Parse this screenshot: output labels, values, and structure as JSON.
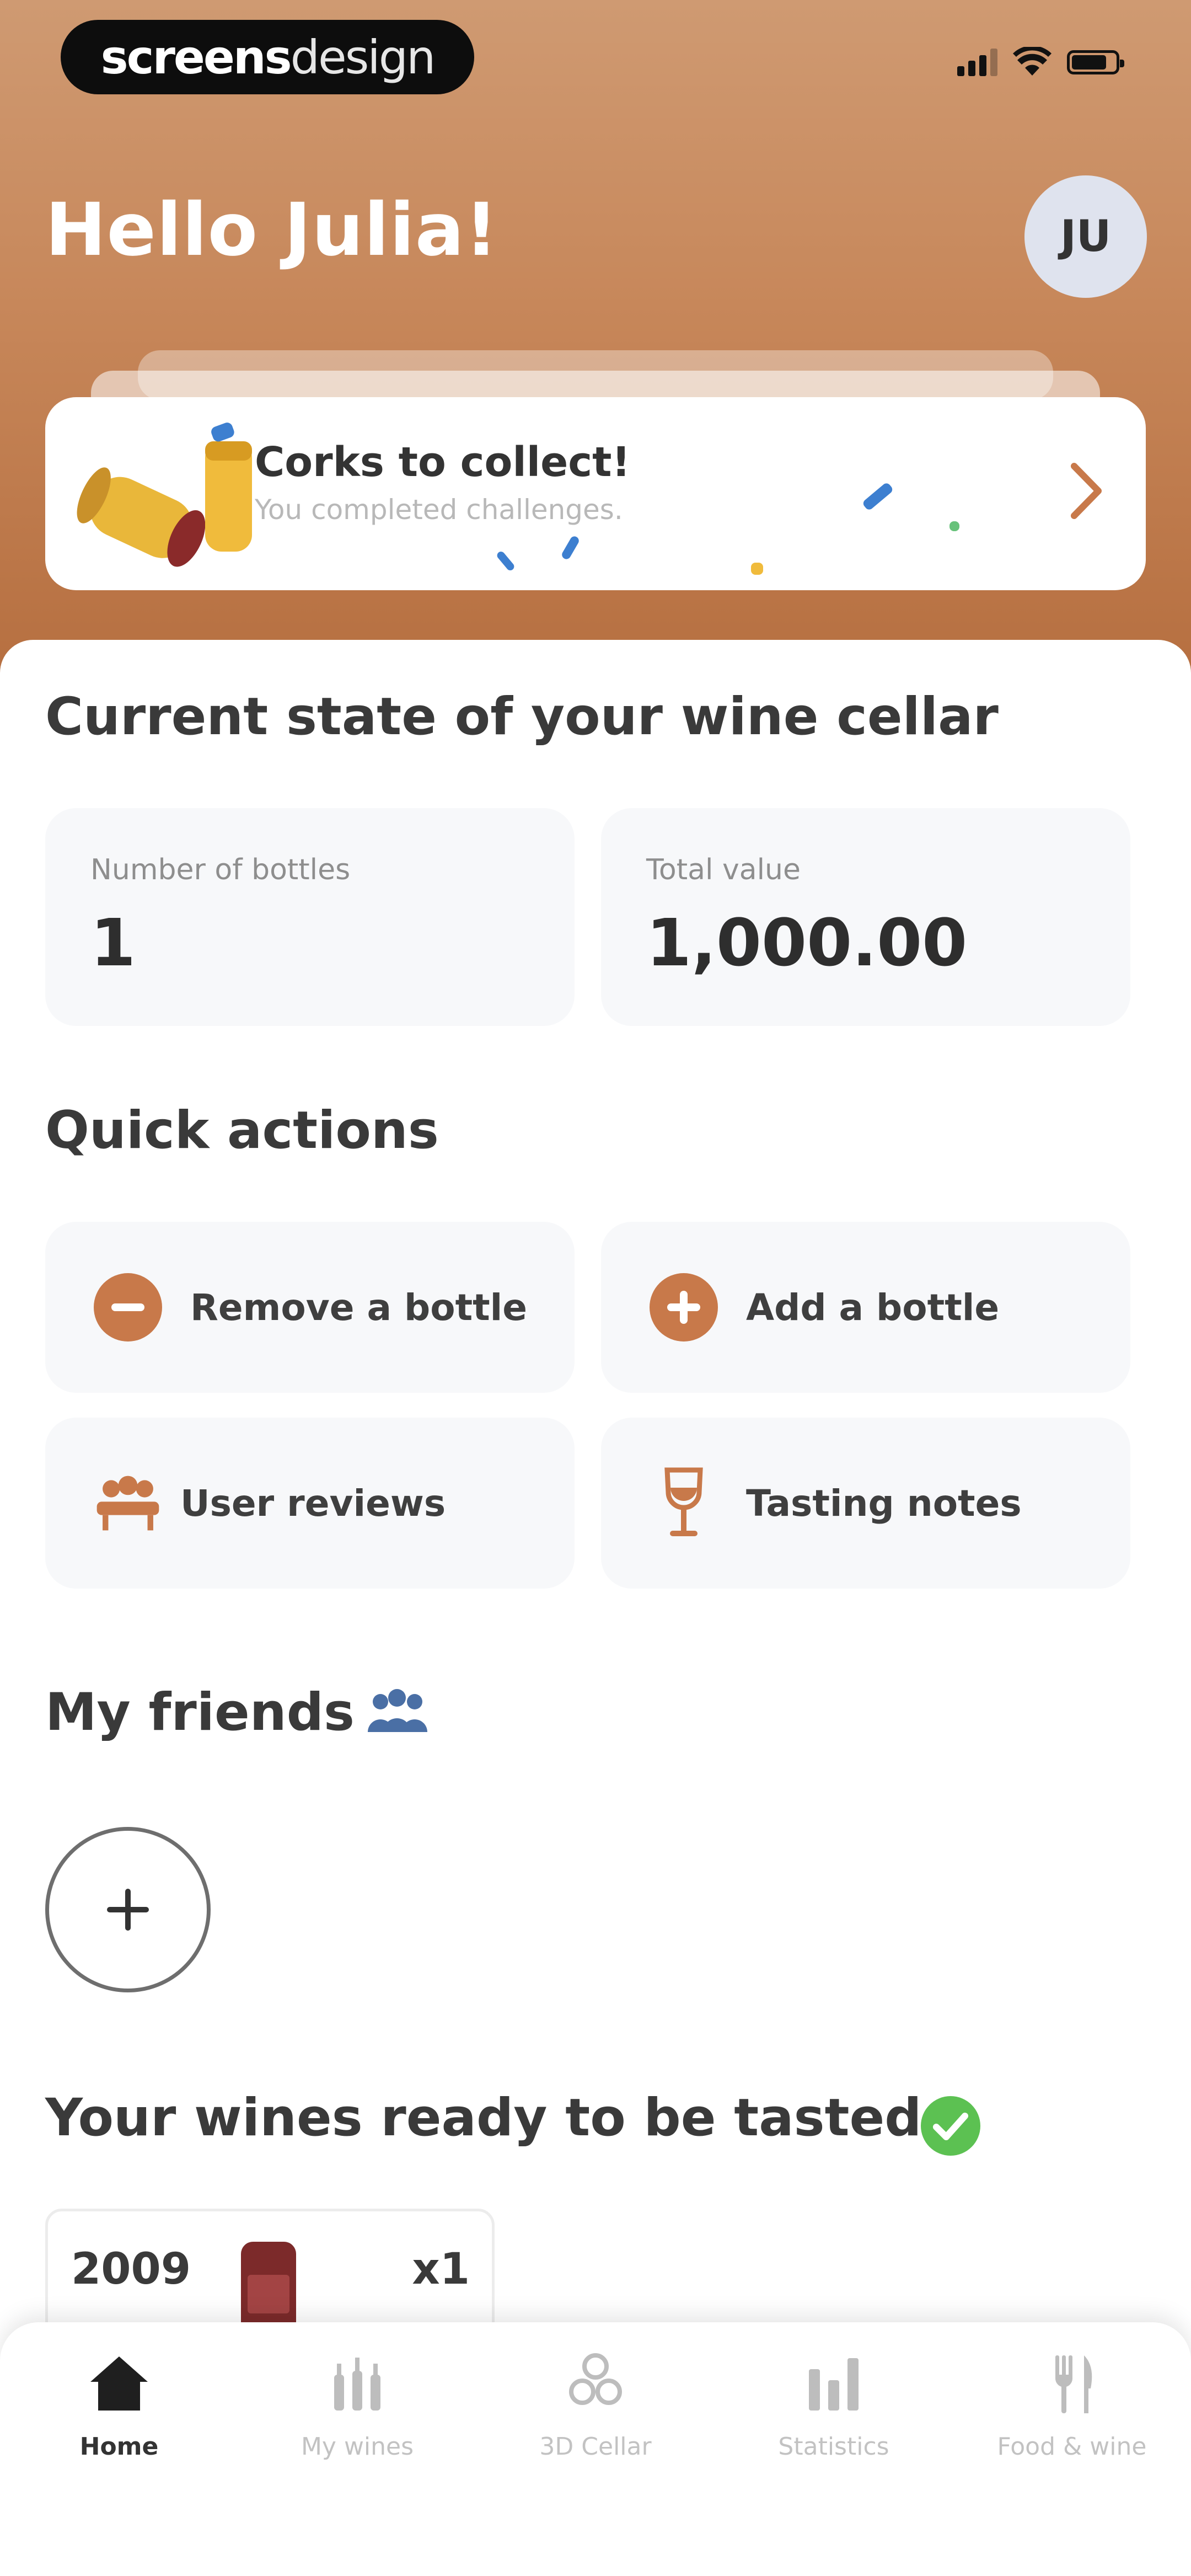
{
  "status_bar": {
    "brand_bold": "screens",
    "brand_light": "design"
  },
  "header": {
    "greeting": "Hello Julia!",
    "avatar_initials": "JU"
  },
  "cork_banner": {
    "title": "Corks to collect!",
    "subtitle": "You completed challenges."
  },
  "cellar": {
    "title": "Current state of your wine cellar",
    "bottles_label": "Number of bottles",
    "bottles_value": "1",
    "value_label": "Total value",
    "value_value": "1,000.00"
  },
  "quick_actions": {
    "title": "Quick actions",
    "remove_label": "Remove a bottle",
    "add_label": "Add a bottle",
    "reviews_label": "User reviews",
    "tasting_label": "Tasting notes"
  },
  "friends": {
    "title": "My friends"
  },
  "ready": {
    "title": "Your wines ready to be tasted",
    "wine_year": "2009",
    "wine_qty": "x1"
  },
  "tabbar": {
    "home": "Home",
    "my_wines": "My wines",
    "cellar_3d": "3D Cellar",
    "statistics": "Statistics",
    "food_wine": "Food & wine"
  },
  "colors": {
    "accent": "#c8794a",
    "header_top": "#cf9a72",
    "header_bottom": "#b66f40",
    "success": "#5cc152"
  }
}
